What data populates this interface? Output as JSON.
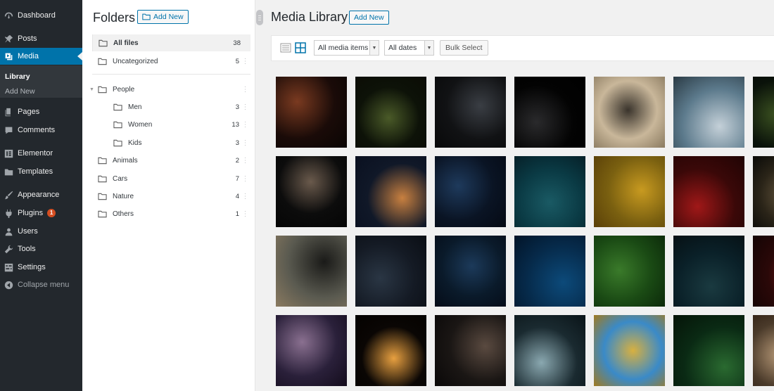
{
  "admin_menu": {
    "items": [
      {
        "label": "Dashboard",
        "icon": "dashboard-icon"
      },
      {
        "label": "Posts",
        "icon": "pin-icon"
      },
      {
        "label": "Media",
        "icon": "media-icon"
      },
      {
        "label": "Pages",
        "icon": "pages-icon"
      },
      {
        "label": "Comments",
        "icon": "comments-icon"
      },
      {
        "label": "Elementor",
        "icon": "elementor-icon"
      },
      {
        "label": "Templates",
        "icon": "folder-icon"
      },
      {
        "label": "Appearance",
        "icon": "brush-icon"
      },
      {
        "label": "Plugins",
        "icon": "plug-icon",
        "badge": "1"
      },
      {
        "label": "Users",
        "icon": "users-icon"
      },
      {
        "label": "Tools",
        "icon": "wrench-icon"
      },
      {
        "label": "Settings",
        "icon": "settings-icon"
      },
      {
        "label": "Collapse menu",
        "icon": "collapse-icon"
      }
    ],
    "submenu": [
      {
        "label": "Library"
      },
      {
        "label": "Add New"
      }
    ],
    "active_color": "#0073aa"
  },
  "folders": {
    "title": "Folders",
    "add_new": "Add New",
    "items": [
      {
        "name": "All files",
        "count": "38"
      },
      {
        "name": "Uncategorized",
        "count": "5"
      },
      {
        "name": "People",
        "count": ""
      },
      {
        "name": "Men",
        "count": "3"
      },
      {
        "name": "Women",
        "count": "13"
      },
      {
        "name": "Kids",
        "count": "3"
      },
      {
        "name": "Animals",
        "count": "2"
      },
      {
        "name": "Cars",
        "count": "7"
      },
      {
        "name": "Nature",
        "count": "4"
      },
      {
        "name": "Others",
        "count": "1"
      }
    ]
  },
  "library": {
    "title": "Media Library",
    "add_new": "Add New",
    "filter_type": "All media items",
    "filter_date": "All dates",
    "bulk_select": "Bulk Select"
  }
}
